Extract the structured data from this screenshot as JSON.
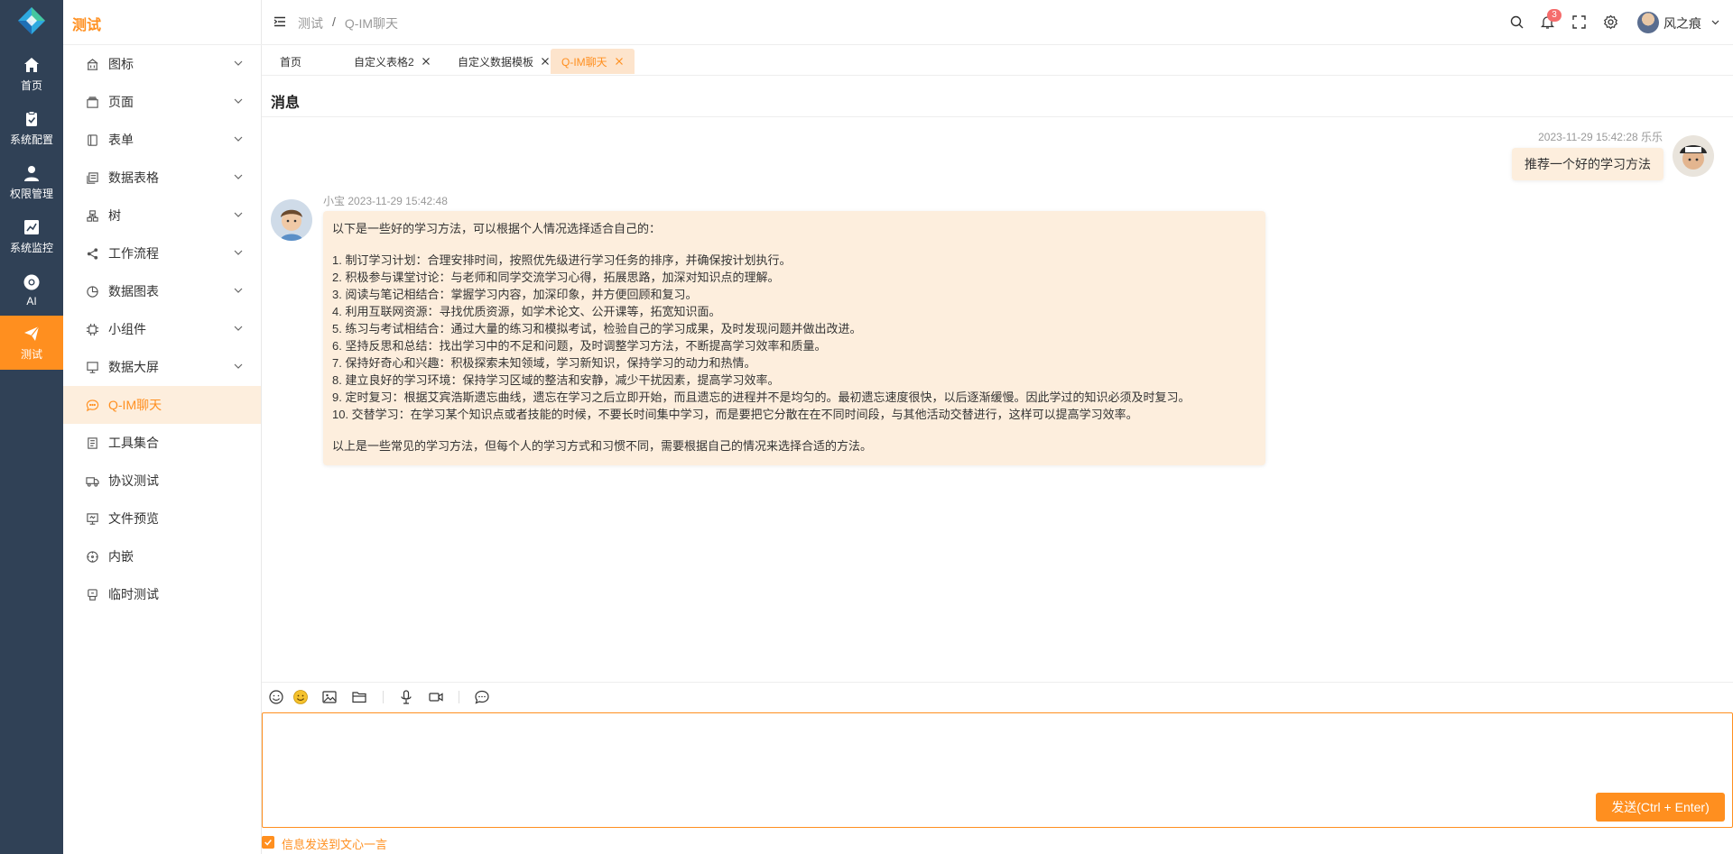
{
  "colors": {
    "accent": "#ff8f1f",
    "rail_bg": "#304156",
    "bubble_bg": "#fdeedd",
    "badge": "#f56c6c"
  },
  "rail": {
    "items": [
      {
        "label": "首页",
        "icon": "home-icon"
      },
      {
        "label": "系统配置",
        "icon": "clipboard-icon"
      },
      {
        "label": "权限管理",
        "icon": "user-icon"
      },
      {
        "label": "系统监控",
        "icon": "chart-icon"
      },
      {
        "label": "AI",
        "icon": "chrome-icon"
      },
      {
        "label": "测试",
        "icon": "send-icon"
      }
    ]
  },
  "sidebar": {
    "title": "测试",
    "items": [
      {
        "label": "图标",
        "icon": "building-icon"
      },
      {
        "label": "页面",
        "icon": "page-icon"
      },
      {
        "label": "表单",
        "icon": "form-icon"
      },
      {
        "label": "数据表格",
        "icon": "table-icon"
      },
      {
        "label": "树",
        "icon": "tree-icon"
      },
      {
        "label": "工作流程",
        "icon": "share-icon"
      },
      {
        "label": "数据图表",
        "icon": "pie-icon"
      },
      {
        "label": "小组件",
        "icon": "cpu-icon"
      },
      {
        "label": "数据大屏",
        "icon": "screen-icon"
      },
      {
        "label": "Q-IM聊天",
        "icon": "chat-icon"
      },
      {
        "label": "工具集合",
        "icon": "tools-icon"
      },
      {
        "label": "协议测试",
        "icon": "truck-icon"
      },
      {
        "label": "文件预览",
        "icon": "preview-icon"
      },
      {
        "label": "内嵌",
        "icon": "compass-icon"
      },
      {
        "label": "临时测试",
        "icon": "temp-icon"
      }
    ]
  },
  "header": {
    "breadcrumb": [
      "测试",
      "Q-IM聊天"
    ],
    "notification_count": "3",
    "user_name": "风之痕"
  },
  "tabs": [
    {
      "label": "首页"
    },
    {
      "label": "自定义表格2"
    },
    {
      "label": "自定义数据模板"
    },
    {
      "label": "Q-IM聊天"
    }
  ],
  "chat": {
    "title": "消息",
    "messages": [
      {
        "side": "right",
        "meta": "2023-11-29 15:42:28 乐乐",
        "text": "推荐一个好的学习方法"
      },
      {
        "side": "left",
        "sender": "小宝",
        "time": "2023-11-29 15:42:48",
        "intro": "以下是一些好的学习方法，可以根据个人情况选择适合自己的：",
        "points": [
          "1. 制订学习计划：合理安排时间，按照优先级进行学习任务的排序，并确保按计划执行。",
          "2. 积极参与课堂讨论：与老师和同学交流学习心得，拓展思路，加深对知识点的理解。",
          "3. 阅读与笔记相结合：掌握学习内容，加深印象，并方便回顾和复习。",
          "4. 利用互联网资源：寻找优质资源，如学术论文、公开课等，拓宽知识面。",
          "5. 练习与考试相结合：通过大量的练习和模拟考试，检验自己的学习成果，及时发现问题并做出改进。",
          "6. 坚持反思和总结：找出学习中的不足和问题，及时调整学习方法，不断提高学习效率和质量。",
          "7. 保持好奇心和兴趣：积极探索未知领域，学习新知识，保持学习的动力和热情。",
          "8. 建立良好的学习环境：保持学习区域的整洁和安静，减少干扰因素，提高学习效率。",
          "9. 定时复习：根据艾宾浩斯遗忘曲线，遗忘在学习之后立即开始，而且遗忘的进程并不是均匀的。最初遗忘速度很快，以后逐渐缓慢。因此学过的知识必须及时复习。",
          "10. 交替学习：在学习某个知识点或者技能的时候，不要长时间集中学习，而是要把它分散在在不同时间段，与其他活动交替进行，这样可以提高学习效率。"
        ],
        "outro": "以上是一些常见的学习方法，但每个人的学习方式和习惯不同，需要根据自己的情况来选择合适的方法。"
      }
    ]
  },
  "composer": {
    "tools": [
      "smile-icon",
      "emoji-icon",
      "image-icon",
      "folder-icon",
      "mic-icon",
      "video-icon",
      "chat-bubble-icon"
    ],
    "input_value": "",
    "send_label": "发送(Ctrl + Enter)",
    "checkbox_label": "信息发送到文心一言"
  }
}
